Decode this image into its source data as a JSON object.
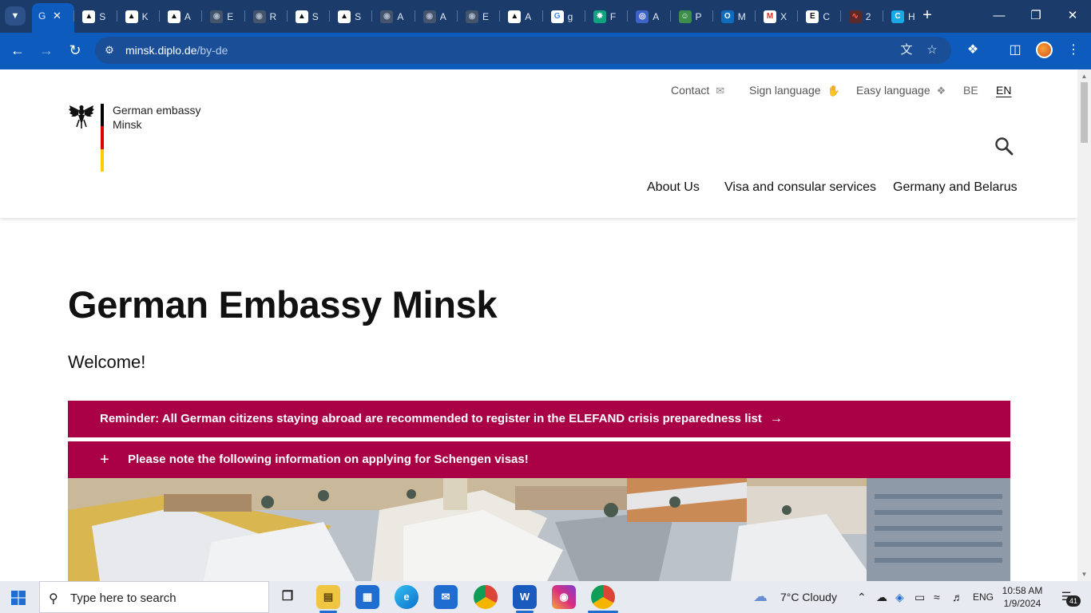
{
  "browser": {
    "tabs": [
      {
        "title": "G",
        "favicon": "globe-icon",
        "active": true
      },
      {
        "title": "S",
        "favicon": "eagle-icon"
      },
      {
        "title": "K",
        "favicon": "eagle-icon"
      },
      {
        "title": "A",
        "favicon": "eagle-icon"
      },
      {
        "title": "E",
        "favicon": "globe-icon"
      },
      {
        "title": "R",
        "favicon": "globe-icon"
      },
      {
        "title": "S",
        "favicon": "eagle-icon"
      },
      {
        "title": "S",
        "favicon": "eagle-icon"
      },
      {
        "title": "A",
        "favicon": "globe-icon"
      },
      {
        "title": "A",
        "favicon": "globe-icon"
      },
      {
        "title": "E",
        "favicon": "globe-icon"
      },
      {
        "title": "A",
        "favicon": "eagle-icon"
      },
      {
        "title": "g",
        "favicon": "google-icon"
      },
      {
        "title": "F",
        "favicon": "openai-icon"
      },
      {
        "title": "A",
        "favicon": "blue-circle-icon"
      },
      {
        "title": "P",
        "favicon": "green-robot-icon"
      },
      {
        "title": "M",
        "favicon": "outlook-icon"
      },
      {
        "title": "X",
        "favicon": "gmail-icon"
      },
      {
        "title": "C",
        "favicon": "e-circle-icon"
      },
      {
        "title": "2",
        "favicon": "red-swirl-icon"
      },
      {
        "title": "H",
        "favicon": "c-circle-icon"
      }
    ],
    "url_host": "minsk.diplo.de",
    "url_path": "/by-de",
    "accent": "#0d5bbd"
  },
  "site": {
    "brand_line1": "German embassy",
    "brand_line2": "Minsk",
    "util_links": {
      "contact": "Contact",
      "sign_language": "Sign language",
      "easy_language": "Easy language",
      "lang_be": "BE",
      "lang_en": "EN"
    },
    "nav": {
      "about": "About Us",
      "visa": "Visa and consular services",
      "germany_belarus": "Germany and Belarus"
    },
    "title": "German Embassy Minsk",
    "welcome": "Welcome!",
    "banner1": "Reminder: All German citizens staying abroad are recommended to register in the ELEFAND crisis preparedness list",
    "banner2_plus": "+",
    "banner2": "Please note the following information on applying for Schengen visas!",
    "banner_color": "#a90046"
  },
  "taskbar": {
    "search_placeholder": "Type here to search",
    "weather": "7°C  Cloudy",
    "lang": "ENG",
    "time": "10:58 AM",
    "date": "1/9/2024",
    "notifications": "41"
  }
}
